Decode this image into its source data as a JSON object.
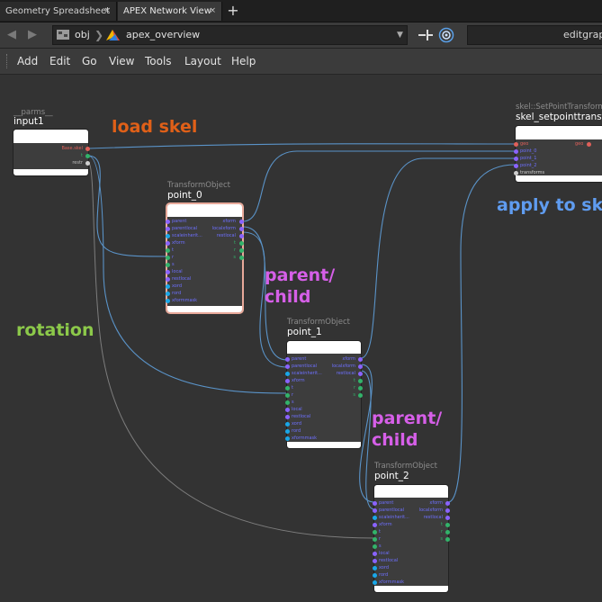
{
  "tabs": [
    {
      "label": "Geometry Spreadsheet",
      "close": "×"
    },
    {
      "label": "APEX Network View",
      "close": "×"
    }
  ],
  "add_tab": "+",
  "path": {
    "segments": [
      "obj",
      "apex_overview"
    ]
  },
  "editgraph": "editgraph",
  "menu": [
    "Add",
    "Edit",
    "Go",
    "View",
    "Tools",
    "Layout",
    "Help"
  ],
  "nodes": {
    "input1": {
      "type": "__parms__",
      "name": "input1",
      "outputs": [
        "Base.skel",
        "t",
        "restr"
      ]
    },
    "point_0": {
      "type": "TransformObject",
      "name": "point_0",
      "inputs": [
        "parent",
        "parentlocal",
        "scaleinherit...",
        "xform",
        "t",
        "r",
        "s",
        "local",
        "restlocal",
        "xord",
        "rord",
        "xformmask"
      ],
      "outputs": [
        "xform",
        "localxform",
        "restlocal",
        "t",
        "r",
        "s"
      ]
    },
    "point_1": {
      "type": "TransformObject",
      "name": "point_1",
      "inputs": [
        "parent",
        "parentlocal",
        "scaleinherit...",
        "xform",
        "t",
        "r",
        "s",
        "local",
        "restlocal",
        "xord",
        "rord",
        "xformmask"
      ],
      "outputs": [
        "xform",
        "localxform",
        "restlocal",
        "t",
        "r",
        "s"
      ]
    },
    "point_2": {
      "type": "TransformObject",
      "name": "point_2",
      "inputs": [
        "parent",
        "parentlocal",
        "scaleinherit...",
        "xform",
        "t",
        "r",
        "s",
        "local",
        "restlocal",
        "xord",
        "rord",
        "xformmask"
      ],
      "outputs": [
        "xform",
        "localxform",
        "restlocal",
        "t",
        "r",
        "s"
      ]
    },
    "skel": {
      "type": "skel::SetPointTransforms",
      "name": "skel_setpointtransforms",
      "inputs": [
        "geo",
        "point_0",
        "point_1",
        "point_2",
        "transforms"
      ],
      "outputs": [
        "geo"
      ]
    }
  },
  "notes": {
    "load_skel": "load skel",
    "apply_to_skel": "apply to skel",
    "parent_child_1": [
      "parent/",
      "child"
    ],
    "parent_child_2": [
      "parent/",
      "child"
    ],
    "rotation": "rotation"
  },
  "colors": {
    "load_skel": "#e06018",
    "apply_to_skel": "#5f9cf0",
    "parent_child": "#d65fe8",
    "rotation": "#8cc94a",
    "wire": "#5a93c8",
    "wire_grey": "#7d7d7d"
  }
}
